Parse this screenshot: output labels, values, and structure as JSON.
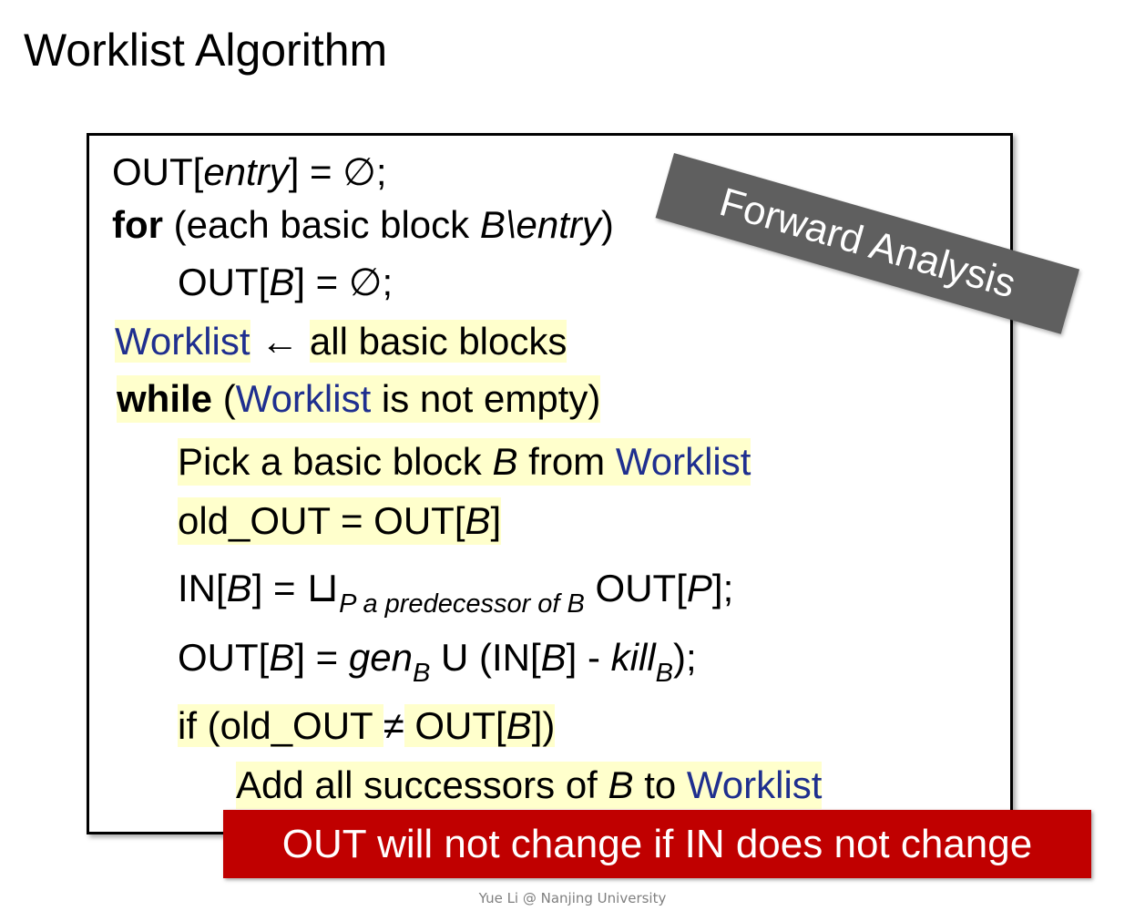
{
  "title": "Worklist Algorithm",
  "algorithm": {
    "l1_a": "OUT[",
    "l1_b": "entry",
    "l1_c": "] = ∅;",
    "l2_a": "for",
    "l2_b": " (each basic block ",
    "l2_c": "B\\entry",
    "l2_d": ")",
    "l3_a": "OUT[",
    "l3_b": "B",
    "l3_c": "] = ∅;",
    "l4_a": "Worklist",
    "l4_b": " ← ",
    "l4_c": "all basic blocks",
    "l5_a": "while",
    "l5_b": " (",
    "l5_c": "Worklist",
    "l5_d": " is not empty)",
    "l6_a": "Pick a basic block ",
    "l6_b": "B",
    "l6_c": " from ",
    "l6_d": "Worklist",
    "l7_a": "old_OUT = OUT[",
    "l7_b": "B",
    "l7_c": "]",
    "l8_a": "IN[",
    "l8_b": "B",
    "l8_c": "] = ",
    "l8_d": "⊔",
    "l8_e": "P a predecessor of B",
    "l8_f": " OUT[",
    "l8_g": "P",
    "l8_h": "];",
    "l9_a": "OUT[",
    "l9_b": "B",
    "l9_c": "] = ",
    "l9_d": "gen",
    "l9_e": "B",
    "l9_f": " U (IN[",
    "l9_g": "B",
    "l9_h": "] - ",
    "l9_i": "kill",
    "l9_j": "B",
    "l9_k": ");",
    "l10_a": "if (old_OUT ",
    "l10_b": "≠",
    "l10_c": " OUT[",
    "l10_d": "B",
    "l10_e": "])",
    "l11_a": "Add all successors of ",
    "l11_b": "B",
    "l11_c": " to ",
    "l11_d": "Worklist"
  },
  "banner": "Forward Analysis",
  "note": "OUT will not change if IN does not change",
  "footer": "Yue Li @ Nanjing University",
  "colors": {
    "keyword_blue": "#1f2f8f",
    "highlight": "#ffffcc",
    "banner_gray": "#5f5f5f",
    "note_red": "#c00000"
  }
}
